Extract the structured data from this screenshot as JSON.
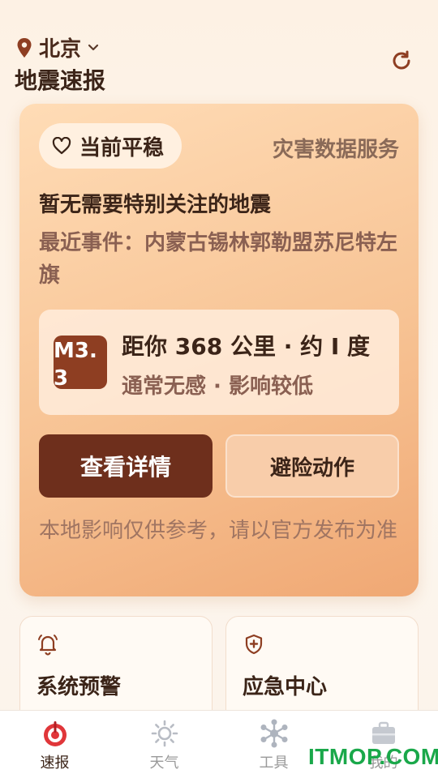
{
  "header": {
    "city": "北京",
    "title": "地震速报"
  },
  "hero": {
    "status_label": "当前平稳",
    "service_label": "灾害数据服务",
    "headline": "暂无需要特别关注的地震",
    "recent_event": "最近事件：内蒙古锡林郭勒盟苏尼特左旗",
    "magnitude": "M3.3",
    "distance": "距你 368 公里 · 约 I 度",
    "impact": "通常无感 · 影响较低",
    "primary_button": "查看详情",
    "secondary_button": "避险动作",
    "note": "本地影响仅供参考，请以官方发布为准"
  },
  "tiles": [
    {
      "label": "系统预警",
      "icon": "bell-alert-icon"
    },
    {
      "label": "应急中心",
      "icon": "shield-plus-icon"
    }
  ],
  "tabs": [
    {
      "label": "速报",
      "icon": "quake-target-icon",
      "active": true
    },
    {
      "label": "天气",
      "icon": "sun-icon",
      "active": false
    },
    {
      "label": "工具",
      "icon": "network-nodes-icon",
      "active": false
    },
    {
      "label": "我的",
      "icon": "briefcase-icon",
      "active": false
    }
  ],
  "watermark": "ITMOP.COM",
  "colors": {
    "accent_dark": "#6e2f1c",
    "magnitude_bg": "#8e3e22",
    "tab_active": "#e0363a",
    "icon_brown": "#8e3e22"
  }
}
